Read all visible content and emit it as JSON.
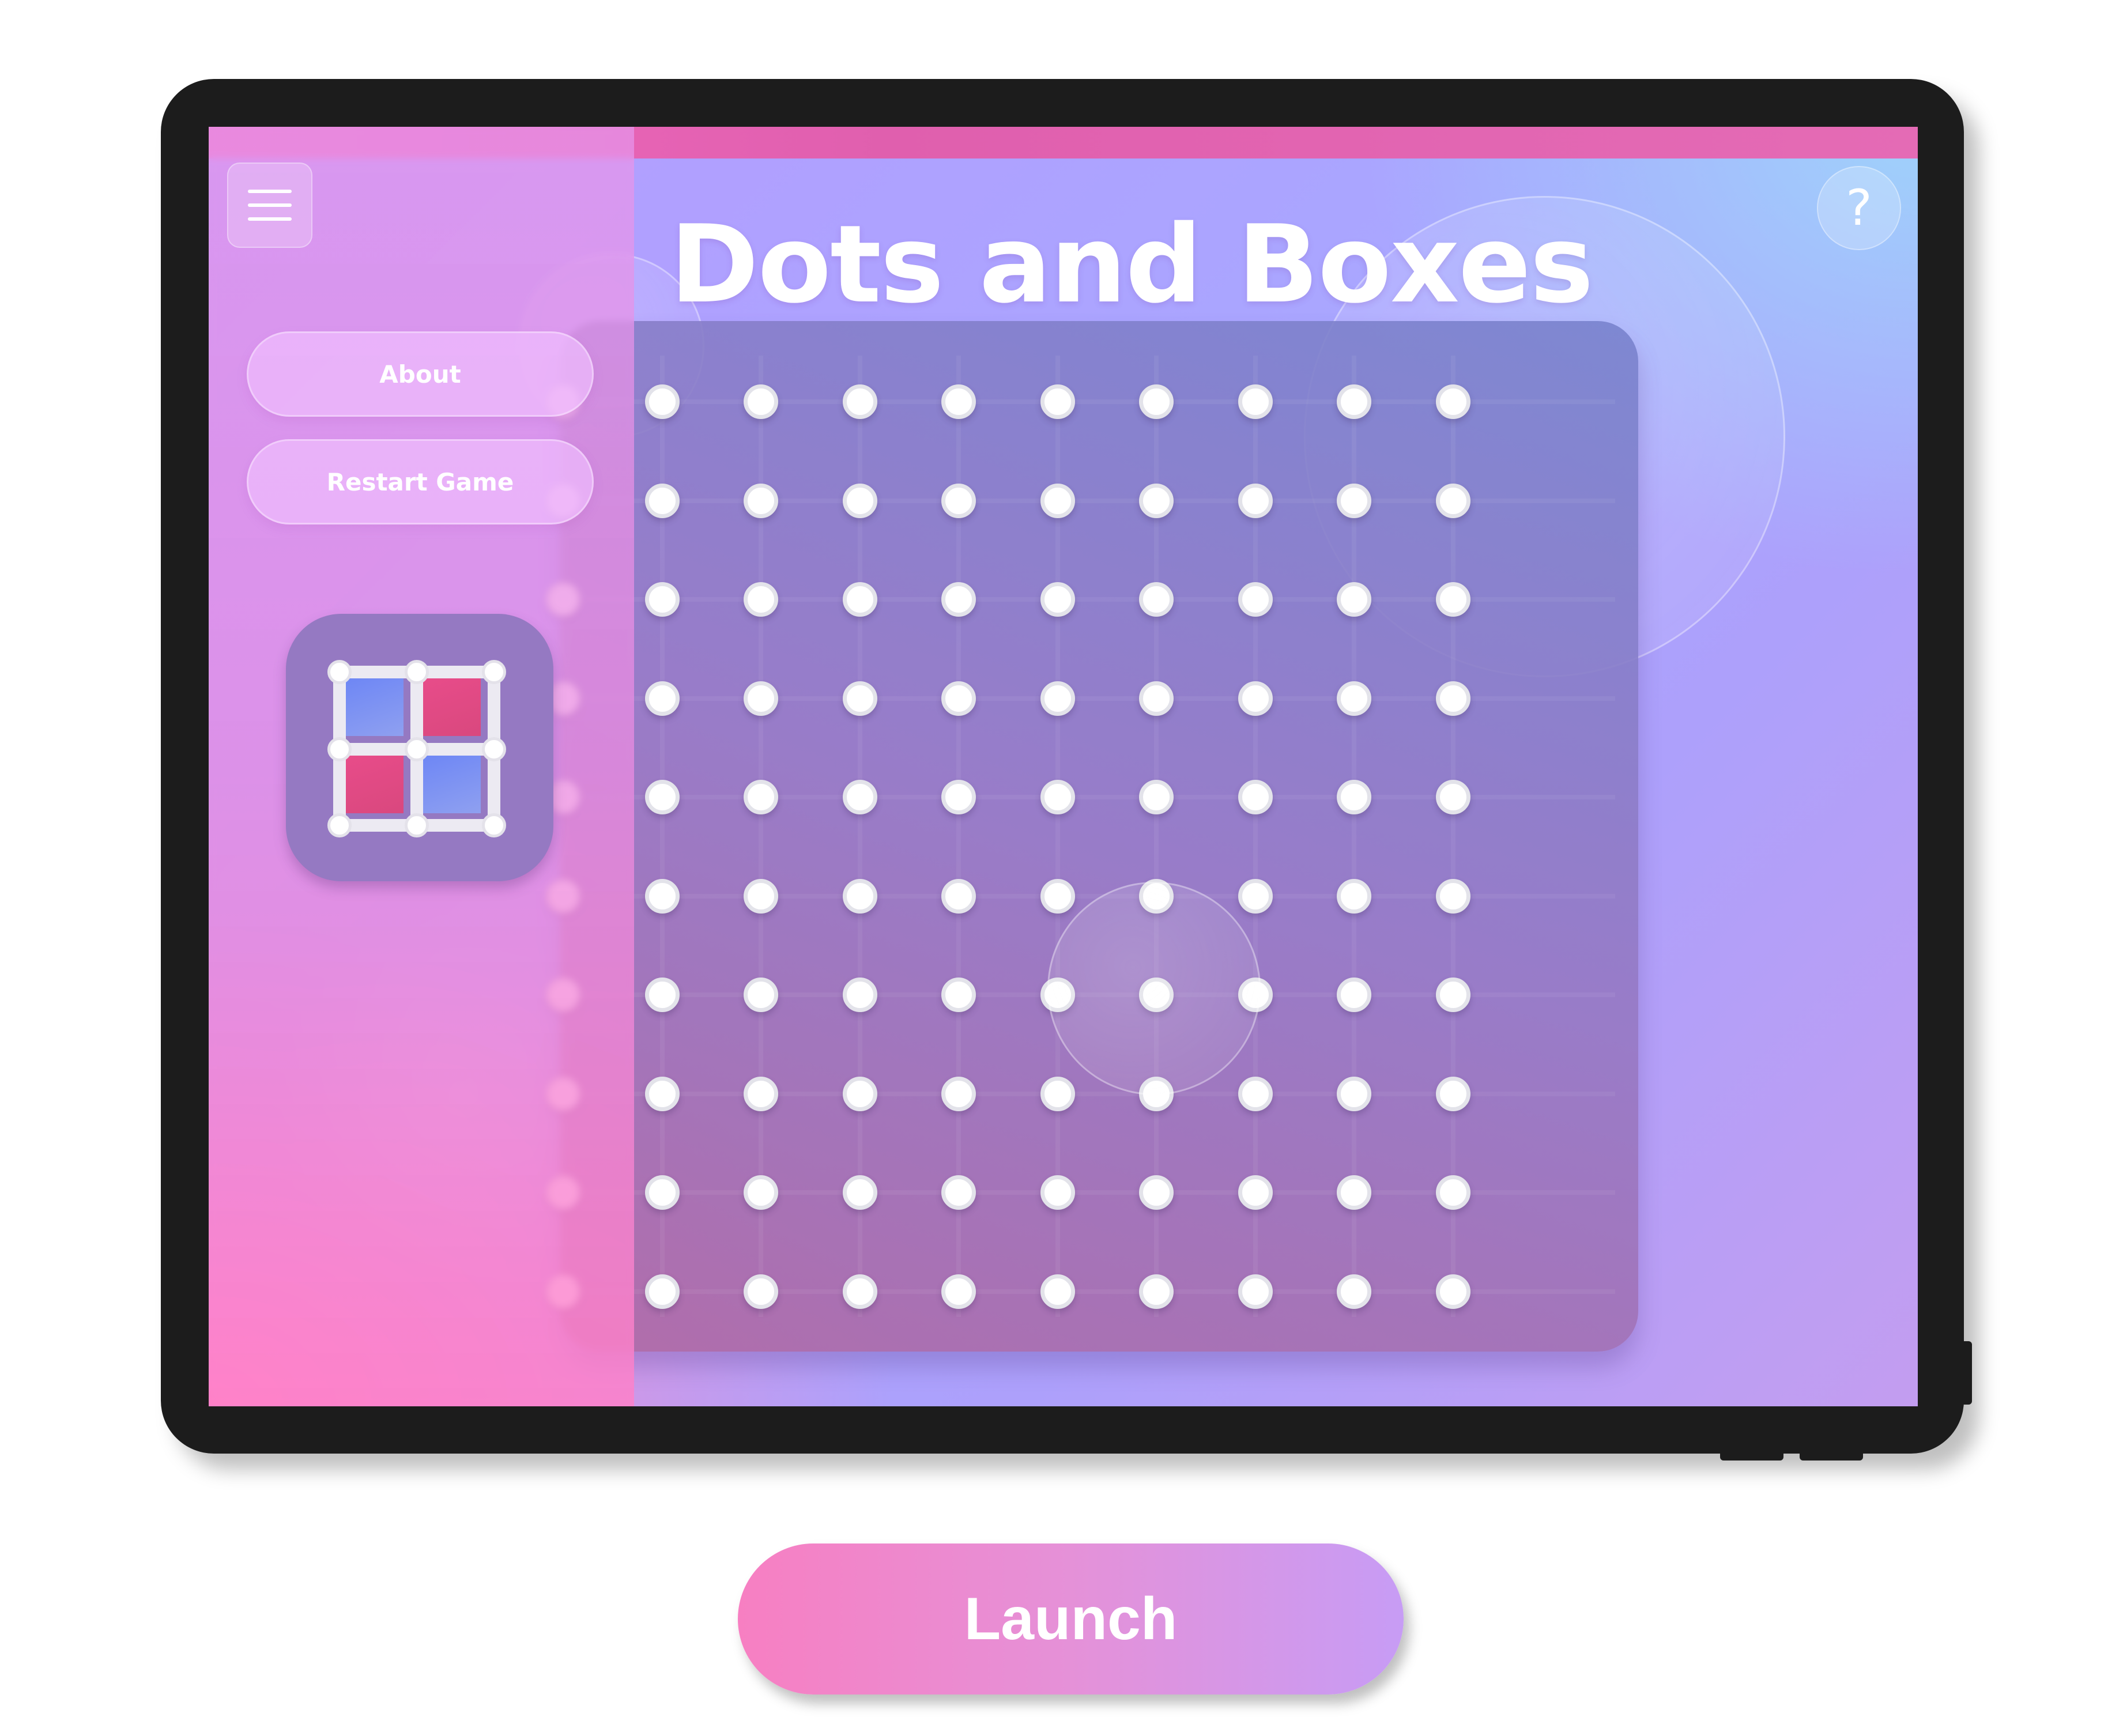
{
  "app": {
    "title": "Dots and Boxes",
    "help_label": "?"
  },
  "sidebar": {
    "menu_icon": "hamburger-menu-icon",
    "items": [
      {
        "label": "About"
      },
      {
        "label": "Restart Game"
      }
    ],
    "app_icon": "dots-and-boxes-icon"
  },
  "board": {
    "columns": 10,
    "rows": 10
  },
  "launch": {
    "label": "Launch"
  },
  "colors": {
    "accent_pink": "#f77fc2",
    "accent_lavender": "#c79cf5",
    "box_blue": "#6d86f5",
    "box_red": "#e84c8a"
  }
}
